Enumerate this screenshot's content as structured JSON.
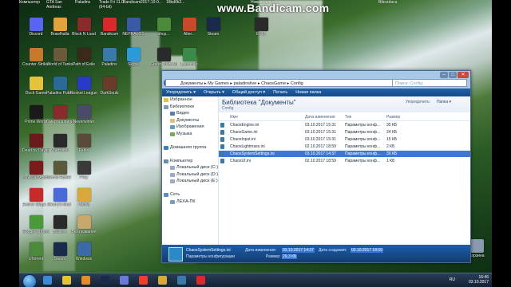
{
  "watermark": {
    "brand": "www.Bandicam.com"
  },
  "top_files": [
    {
      "label": "Компьютер"
    },
    {
      "label": "GTA San Andreas"
    },
    {
      "label": "Paladins"
    },
    {
      "label": "Trade Fri 11.0 (64-bit)"
    },
    {
      "label": "Bandicam"
    },
    {
      "label": "2017-10-0..."
    },
    {
      "label": "18bd0k2..."
    },
    {
      "label": "Новая папка"
    },
    {
      "label": "Bibozdaca"
    }
  ],
  "desktop_icons": [
    {
      "label": "Discord"
    },
    {
      "label": "Brawlhalla"
    },
    {
      "label": "Block N Load"
    },
    {
      "label": "Bandicam"
    },
    {
      "label": "NEPHALOS"
    },
    {
      "label": "ohcp..."
    },
    {
      "label": "Alter..."
    },
    {
      "label": "Steam"
    },
    {
      "label": "EPIC"
    },
    {
      "label": "Counter-Strike: Global Off..."
    },
    {
      "label": "World of Tanks"
    },
    {
      "label": "Path of Exile"
    },
    {
      "label": "Paladins"
    },
    {
      "label": "Skype"
    },
    {
      "label": "Grand Theft Auto"
    },
    {
      "label": "Launcher"
    },
    {
      "label": "Duck Game"
    },
    {
      "label": "Paladins Public Test"
    },
    {
      "label": "Rocket League"
    },
    {
      "label": "DarkSouls"
    },
    {
      "label": "Prime World"
    },
    {
      "label": "Смерть шпионам"
    },
    {
      "label": "Neverwinter"
    },
    {
      "label": "Dead by Daylight"
    },
    {
      "label": "Warframe"
    },
    {
      "label": "Fable"
    },
    {
      "label": "MTA San Andreas"
    },
    {
      "label": "Tomb Raider"
    },
    {
      "label": "Prey"
    },
    {
      "label": "Evolve Stage 2"
    },
    {
      "label": "Garry's Mod"
    },
    {
      "label": "Папка"
    },
    {
      "label": "Google Chrome"
    },
    {
      "label": "Ballistic"
    },
    {
      "label": "Без названия"
    },
    {
      "label": "uTorrent"
    },
    {
      "label": "Steam"
    },
    {
      "label": "Windows"
    },
    {
      "label": "Корзина"
    }
  ],
  "window": {
    "controls": [
      "–",
      "□",
      "✕"
    ],
    "address_path": "Документы  ▸  My Games  ▸  paladinslive  ▸  ChaosGame  ▸  Config",
    "search_placeholder": "Поиск: Config",
    "toolbar": [
      "Упорядочить ▾",
      "Открыть ▾",
      "Общий доступ ▾",
      "Печать",
      "Новая папка"
    ],
    "nav": [
      {
        "label": "Избранное",
        "sub": false,
        "color": "#e6c23a"
      },
      {
        "label": "Библиотеки",
        "sub": false,
        "color": "#7a9ac8"
      },
      {
        "label": "Видео",
        "sub": true,
        "color": "#5a7ab0"
      },
      {
        "label": "Документы",
        "sub": true,
        "color": "#d8c080"
      },
      {
        "label": "Изображения",
        "sub": true,
        "color": "#5aa0c8"
      },
      {
        "label": "Музыка",
        "sub": true,
        "color": "#7aa85a"
      },
      {
        "label": "",
        "sub": false,
        "color": ""
      },
      {
        "label": "Домашняя группа",
        "sub": false,
        "color": "#3a80c8"
      },
      {
        "label": "",
        "sub": false,
        "color": ""
      },
      {
        "label": "Компьютер",
        "sub": false,
        "color": "#6a8ab0"
      },
      {
        "label": "Локальный диск (C:)",
        "sub": true,
        "color": "#9aaac0"
      },
      {
        "label": "Локальный диск (D:)",
        "sub": true,
        "color": "#9aaac0"
      },
      {
        "label": "Локальный диск (E:)",
        "sub": true,
        "color": "#9aaac0"
      },
      {
        "label": "",
        "sub": false,
        "color": ""
      },
      {
        "label": "Сеть",
        "sub": false,
        "color": "#5a8ac8"
      },
      {
        "label": "ЛЕХА-ПК",
        "sub": true,
        "color": "#7a9ac8"
      }
    ],
    "library_title": "Библиотека \"Документы\"",
    "library_sub": "Config",
    "arrange_label": "Упорядочить:",
    "arrange_value": "Папка ▾",
    "columns": {
      "name": "Имя",
      "date": "Дата изменения",
      "type": "Тип",
      "size": "Размер"
    },
    "files": [
      {
        "name": "ChaosEngine.ini",
        "date": "03.10.2017 15:31",
        "type": "Параметры конф...",
        "size": "35 КБ",
        "selected": false
      },
      {
        "name": "ChaosGame.ini",
        "date": "03.10.2017 15:31",
        "type": "Параметры конф...",
        "size": "24 КБ",
        "selected": false
      },
      {
        "name": "ChaosInput.ini",
        "date": "03.10.2017 15:31",
        "type": "Параметры конф...",
        "size": "15 КБ",
        "selected": false
      },
      {
        "name": "ChaosLightmass.ini",
        "date": "02.10.2017 18:59",
        "type": "Параметры конф...",
        "size": "2 КБ",
        "selected": false
      },
      {
        "name": "ChaosSystemSettings.ini",
        "date": "03.10.2017 14:37",
        "type": "Параметры конф...",
        "size": "30 КБ",
        "selected": true
      },
      {
        "name": "ChaosUI.ini",
        "date": "02.10.2017 18:59",
        "type": "Параметры конф...",
        "size": "1 КБ",
        "selected": false
      }
    ],
    "status": {
      "filename": "ChaosSystemSettings.ini",
      "filetype": "Параметры конфигурации",
      "modified_label": "Дата изменения:",
      "modified_value": "03.10.2017 14:37",
      "size_label": "Размер:",
      "size_value": "29,3 КБ",
      "created_label": "Дата создания:",
      "created_value": "02.10.2017 18:59"
    }
  },
  "taskbar": {
    "lang": "RU",
    "time": "16:46",
    "date": "03.10.2017",
    "apps": [
      {
        "name": "ie-icon",
        "color": "#3a8ad8"
      },
      {
        "name": "explorer-icon",
        "color": "#e6c23a"
      },
      {
        "name": "media-player-icon",
        "color": "#e88a2a"
      },
      {
        "name": "steam-icon",
        "color": "#1a2a4a"
      },
      {
        "name": "discord-icon",
        "color": "#6a7ad8"
      },
      {
        "name": "chrome-icon",
        "color": "#e6422a"
      },
      {
        "name": "folder-icon",
        "color": "#d8a83a"
      },
      {
        "name": "paladins-icon",
        "color": "#3a7aaa"
      },
      {
        "name": "bandicam-icon",
        "color": "#d82a2a"
      }
    ]
  }
}
